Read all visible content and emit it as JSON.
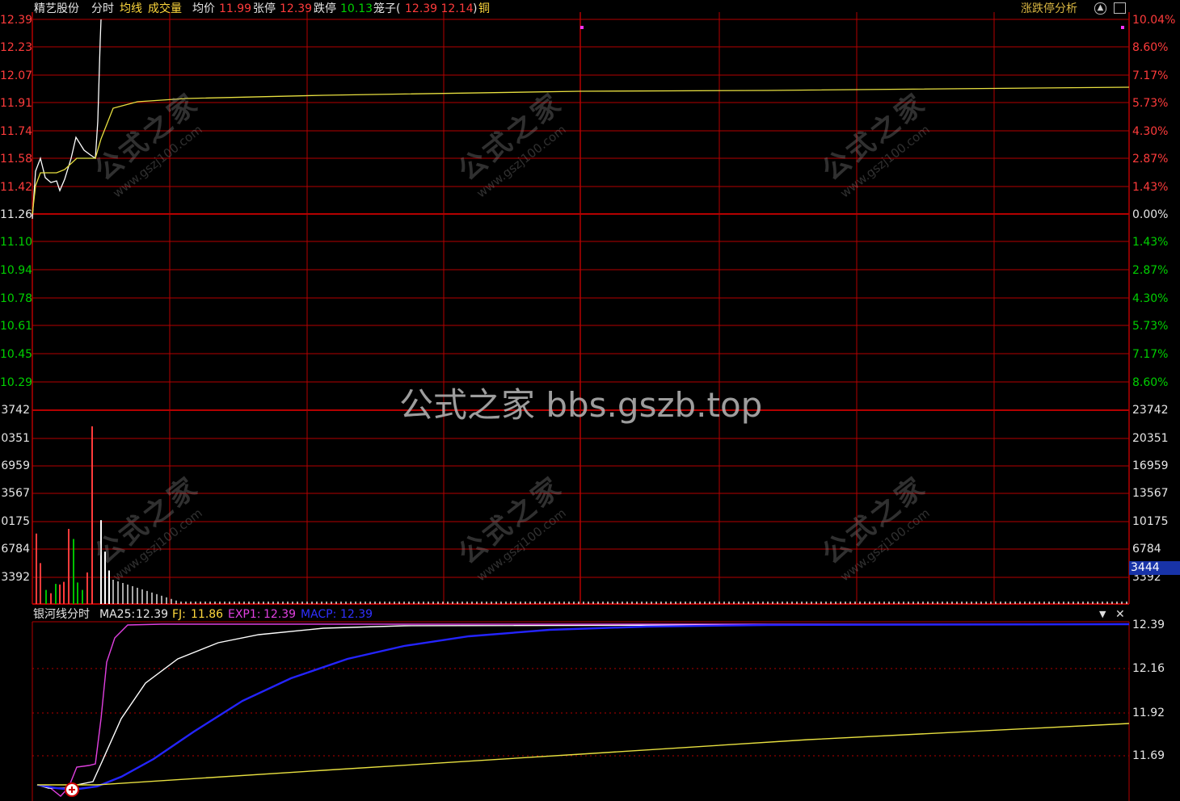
{
  "header": {
    "stock_name": "精艺股份",
    "tab_time": "分时",
    "tab_avg": "均线",
    "tab_vol": "成交量",
    "avg_label": "均价",
    "avg_value": "11.99",
    "up_limit_label": "张停",
    "up_limit_value": "12.39",
    "down_limit_label": "跌停",
    "down_limit_value": "10.13",
    "cage_label": "笼子(",
    "cage_value": "12.39 12.14",
    "cage_close": ")",
    "tag": "铜",
    "analysis_button": "涨跌停分析"
  },
  "price_axis": {
    "left": [
      "12.39",
      "12.23",
      "12.07",
      "11.91",
      "11.74",
      "11.58",
      "11.42",
      "11.26",
      "11.10",
      "10.94",
      "10.78",
      "10.61",
      "10.45",
      "10.29"
    ],
    "right": [
      "10.04%",
      "8.60%",
      "7.17%",
      "5.73%",
      "4.30%",
      "2.87%",
      "1.43%",
      "0.00%",
      "1.43%",
      "2.87%",
      "4.30%",
      "5.73%",
      "7.17%",
      "8.60%"
    ],
    "colors": [
      "#ff3b3b",
      "#ff3b3b",
      "#ff3b3b",
      "#ff3b3b",
      "#ff3b3b",
      "#ff3b3b",
      "#ff3b3b",
      "#e6e6e6",
      "#00d000",
      "#00d000",
      "#00d000",
      "#00d000",
      "#00d000",
      "#00d000"
    ]
  },
  "volume_axis": {
    "left": [
      "3742",
      "0351",
      "6959",
      "3567",
      "0175",
      "6784",
      "3392"
    ],
    "right": [
      "23742",
      "20351",
      "16959",
      "13567",
      "10175",
      "6784",
      "3392"
    ],
    "current": "3444"
  },
  "indicator": {
    "name": "银河线分时",
    "ma25_label": "MA25:",
    "ma25_value": "12.39",
    "fj_label": "FJ:",
    "fj_value": "11.86",
    "exp1_label": "EXP1:",
    "exp1_value": "12.39",
    "macp_label": "MACP:",
    "macp_value": "12.39",
    "axis": [
      "12.39",
      "12.16",
      "11.92",
      "11.69"
    ]
  },
  "watermark": {
    "center": "公式之家 bbs.gszb.top",
    "tile_big": "公式之家",
    "tile_small": "www.gszj100.com"
  },
  "colors": {
    "price_line": "#ffffff",
    "avg_line": "#e8e040",
    "grid": "#b40000",
    "vol_up": "#ff3b3b",
    "vol_down": "#00c000",
    "ma25": "#ffffff",
    "fj": "#e8e040",
    "exp1": "#e040e0",
    "macp": "#2424ff"
  },
  "chart_data": {
    "type": "line",
    "series": [
      {
        "name": "分时",
        "color": "#ffffff",
        "values": [
          11.26,
          11.5,
          11.58,
          11.54,
          11.48,
          11.5,
          11.46,
          11.52,
          11.56,
          11.66,
          11.66,
          11.58,
          11.66,
          12.39,
          12.39,
          12.39
        ]
      },
      {
        "name": "均价",
        "color": "#e8e040",
        "values": [
          11.26,
          11.44,
          11.5,
          11.5,
          11.5,
          11.52,
          11.56,
          11.58,
          11.58,
          11.6,
          11.8,
          11.87,
          11.9,
          11.99
        ]
      }
    ],
    "volume": [
      10500,
      6100,
      2100,
      1600,
      3000,
      2900,
      3300,
      11200,
      9700,
      3200,
      2100,
      4700,
      26500,
      12500,
      7800,
      5000
    ]
  }
}
